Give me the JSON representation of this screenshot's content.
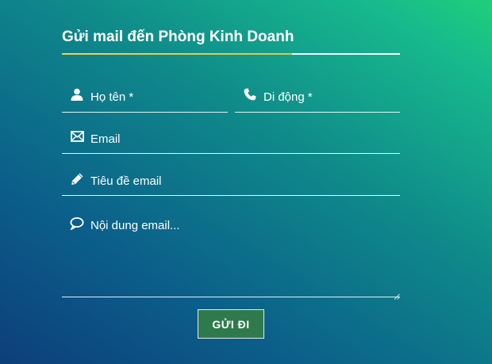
{
  "form": {
    "title": "Gửi mail đến Phòng Kinh Doanh",
    "fields": {
      "name": {
        "placeholder": "Họ tên *",
        "icon": "user-icon"
      },
      "phone": {
        "placeholder": "Di động *",
        "icon": "phone-icon"
      },
      "email": {
        "placeholder": "Email",
        "icon": "envelope-icon"
      },
      "subject": {
        "placeholder": "Tiêu đề email",
        "icon": "pencil-icon"
      },
      "content": {
        "placeholder": "Nội dung email...",
        "icon": "speech-bubble-icon"
      }
    },
    "submit_label": "GỬI ĐI"
  },
  "colors": {
    "accent_underline": "#f2d34b",
    "button_background": "#2f7a4c",
    "background_start": "#0d3f7a",
    "background_end": "#1fcf7a"
  }
}
